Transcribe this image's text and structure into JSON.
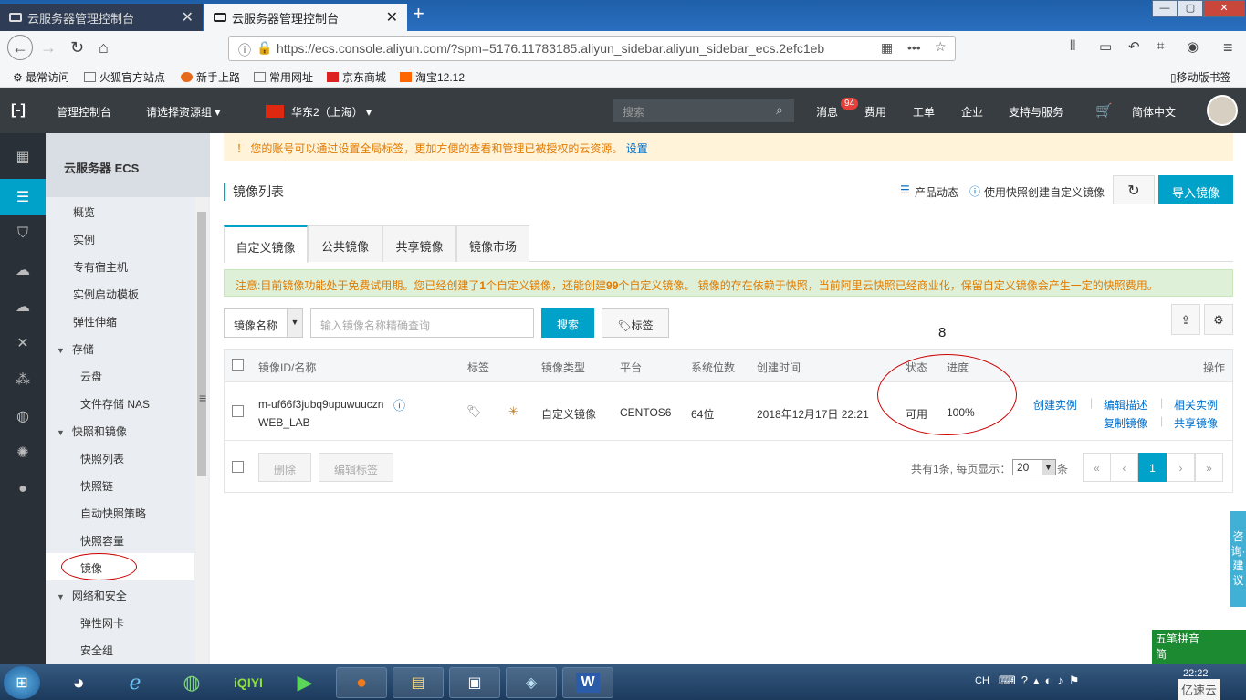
{
  "browser": {
    "tabs": [
      {
        "label": "云服务器管理控制台",
        "active": false
      },
      {
        "label": "云服务器管理控制台",
        "active": true
      }
    ],
    "url": "https://ecs.console.aliyun.com/?spm=5176.11783185.aliyun_sidebar.aliyun_sidebar_ecs.2efc1eb",
    "bookmarks": [
      "最常访问",
      "火狐官方站点",
      "新手上路",
      "常用网址",
      "京东商城",
      "淘宝12.12"
    ],
    "mobile_bookmarks": "移动版书签"
  },
  "topbar": {
    "console": "管理控制台",
    "resource_group": "请选择资源组",
    "region": "华东2（上海）",
    "search_placeholder": "搜索",
    "messages": "消息",
    "message_count": "94",
    "links": [
      "费用",
      "工单",
      "企业",
      "支持与服务"
    ],
    "language": "简体中文"
  },
  "sidebar": {
    "title": "云服务器 ECS",
    "items": [
      {
        "label": "概览",
        "level": 1
      },
      {
        "label": "实例",
        "level": 1
      },
      {
        "label": "专有宿主机",
        "level": 1
      },
      {
        "label": "实例启动模板",
        "level": 1
      },
      {
        "label": "弹性伸缩",
        "level": 1
      },
      {
        "label": "存储",
        "level": 0
      },
      {
        "label": "云盘",
        "level": 2
      },
      {
        "label": "文件存储 NAS",
        "level": 2
      },
      {
        "label": "快照和镜像",
        "level": 0
      },
      {
        "label": "快照列表",
        "level": 2
      },
      {
        "label": "快照链",
        "level": 2
      },
      {
        "label": "自动快照策略",
        "level": 2
      },
      {
        "label": "快照容量",
        "level": 2
      },
      {
        "label": "镜像",
        "level": 2,
        "active": true
      },
      {
        "label": "网络和安全",
        "level": 0
      },
      {
        "label": "弹性网卡",
        "level": 2
      },
      {
        "label": "安全组",
        "level": 2
      }
    ]
  },
  "notice": {
    "text": "您的账号可以通过设置全局标签，更加方便的查看和管理已被授权的云资源。",
    "link": "设置"
  },
  "page": {
    "title": "镜像列表",
    "product_news": "产品动态",
    "help_link": "使用快照创建自定义镜像",
    "import_button": "导入镜像",
    "tabs": [
      "自定义镜像",
      "公共镜像",
      "共享镜像",
      "镜像市场"
    ],
    "info_prefix": "注意:目前镜像功能处于免费试用期。您已经创建了",
    "info_created": "1",
    "info_mid": "个自定义镜像，还能创建",
    "info_remaining": "99",
    "info_suffix": "个自定义镜像。 镜像的存在依赖于快照，当前阿里云快照已经商业化，保留自定义镜像会产生一定的快照费用。",
    "filter_select": "镜像名称",
    "search_placeholder": "输入镜像名称精确查询",
    "search_button": "搜索",
    "tag_button": "标签",
    "annotation": "8"
  },
  "table": {
    "headers": [
      "镜像ID/名称",
      "标签",
      "镜像类型",
      "平台",
      "系统位数",
      "创建时间",
      "状态",
      "进度",
      "操作"
    ],
    "rows": [
      {
        "id": "m-uf66f3jubq9upuwuuczn",
        "name": "WEB_LAB",
        "type": "自定义镜像",
        "platform": "CENTOS6",
        "bits": "64位",
        "created": "2018年12月17日 22:21",
        "status": "可用",
        "progress": "100%",
        "actions": [
          "创建实例",
          "编辑描述",
          "相关实例",
          "复制镜像",
          "共享镜像"
        ]
      }
    ],
    "footer": {
      "delete": "删除",
      "edit_tags": "编辑标签",
      "summary": "共有1条, 每页显示：",
      "page_size": "20",
      "unit": "条",
      "pages": [
        "«",
        "‹",
        "1",
        "›",
        "»"
      ]
    }
  },
  "consult": "咨询·建议",
  "ime": {
    "line1": "五笔拼音",
    "line2": "简"
  },
  "taskbar": {
    "tray": "CH",
    "clock": "22:22",
    "watermark": "亿速云"
  }
}
